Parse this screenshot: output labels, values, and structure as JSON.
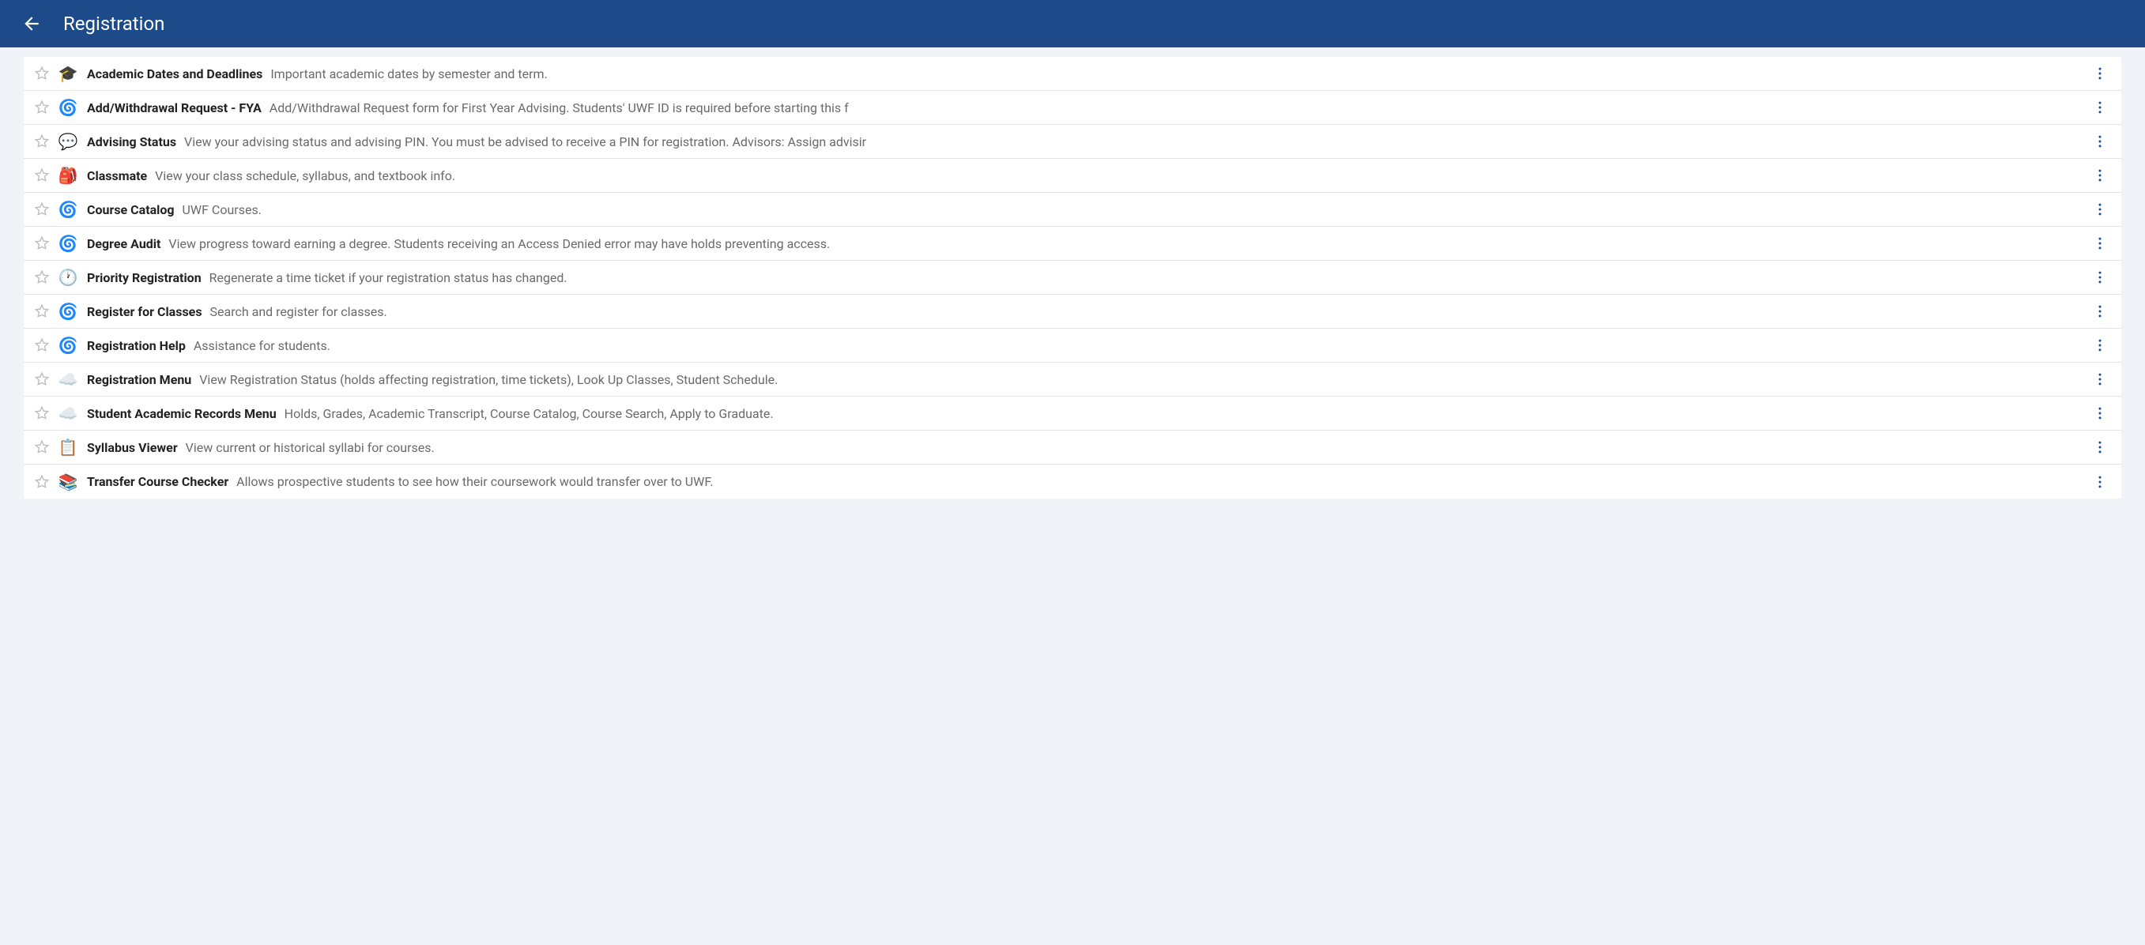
{
  "header": {
    "title": "Registration"
  },
  "items": [
    {
      "icon": "🎓",
      "title": "Academic Dates and Deadlines",
      "desc": "Important academic dates by semester and term."
    },
    {
      "icon": "🌀",
      "title": "Add/Withdrawal Request - FYA",
      "desc": "Add/Withdrawal Request form for First Year Advising. Students' UWF ID is required before starting this f"
    },
    {
      "icon": "💬",
      "title": "Advising Status",
      "desc": "View your advising status and advising PIN. You must be advised to receive a PIN for registration. Advisors: Assign advisir"
    },
    {
      "icon": "🎒",
      "title": "Classmate",
      "desc": "View your class schedule, syllabus, and textbook info."
    },
    {
      "icon": "🌀",
      "title": "Course Catalog",
      "desc": "UWF Courses."
    },
    {
      "icon": "🌀",
      "title": "Degree Audit",
      "desc": "View progress toward earning a degree. Students receiving an Access Denied error may have holds preventing access."
    },
    {
      "icon": "🕐",
      "title": "Priority Registration",
      "desc": "Regenerate a time ticket if your registration status has changed."
    },
    {
      "icon": "🌀",
      "title": "Register for Classes",
      "desc": "Search and register for classes."
    },
    {
      "icon": "🌀",
      "title": "Registration Help",
      "desc": "Assistance for students."
    },
    {
      "icon": "☁️",
      "title": "Registration Menu",
      "desc": "View Registration Status (holds affecting registration, time tickets), Look Up Classes, Student Schedule."
    },
    {
      "icon": "☁️",
      "title": "Student Academic Records Menu",
      "desc": "Holds, Grades, Academic Transcript, Course Catalog, Course Search, Apply to Graduate."
    },
    {
      "icon": "📋",
      "title": "Syllabus Viewer",
      "desc": "View current or historical syllabi for courses."
    },
    {
      "icon": "📚",
      "title": "Transfer Course Checker",
      "desc": "Allows prospective students to see how their coursework would transfer over to UWF."
    }
  ]
}
